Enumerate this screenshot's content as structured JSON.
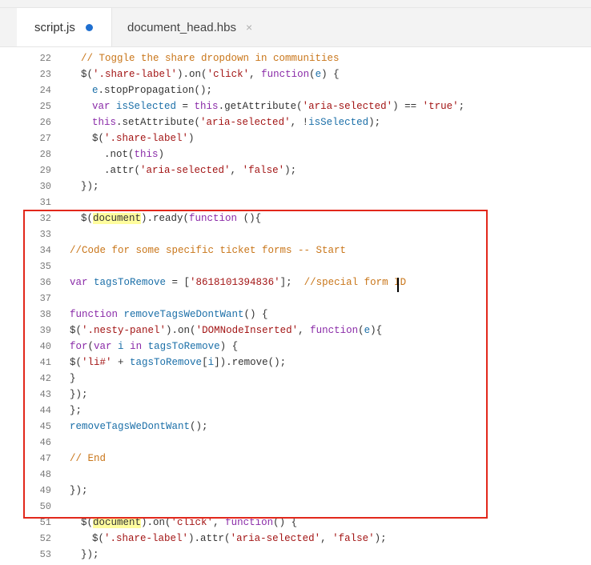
{
  "tabs": [
    {
      "label": "script.js",
      "active": true,
      "modified": true
    },
    {
      "label": "document_head.hbs",
      "active": false,
      "close": "×"
    }
  ],
  "lines": [
    {
      "n": "22",
      "segs": [
        {
          "t": "// Toggle the share dropdown in communities",
          "c": "c-com"
        }
      ]
    },
    {
      "n": "23",
      "segs": [
        {
          "t": "$(",
          "c": "c-fn"
        },
        {
          "t": "'.share-label'",
          "c": "c-str"
        },
        {
          "t": ").on(",
          "c": "c-fn"
        },
        {
          "t": "'click'",
          "c": "c-str"
        },
        {
          "t": ", ",
          "c": "c-fn"
        },
        {
          "t": "function",
          "c": "c-kw"
        },
        {
          "t": "(",
          "c": "c-fn"
        },
        {
          "t": "e",
          "c": "c-id"
        },
        {
          "t": ") {",
          "c": "c-fn"
        }
      ]
    },
    {
      "n": "24",
      "segs": [
        {
          "t": "e",
          "c": "c-id"
        },
        {
          "t": ".stopPropagation();",
          "c": "c-fn"
        }
      ]
    },
    {
      "n": "25",
      "segs": [
        {
          "t": "var ",
          "c": "c-kw"
        },
        {
          "t": "isSelected",
          "c": "c-id"
        },
        {
          "t": " = ",
          "c": "c-fn"
        },
        {
          "t": "this",
          "c": "c-kw"
        },
        {
          "t": ".getAttribute(",
          "c": "c-fn"
        },
        {
          "t": "'aria-selected'",
          "c": "c-str"
        },
        {
          "t": ") == ",
          "c": "c-fn"
        },
        {
          "t": "'true'",
          "c": "c-str"
        },
        {
          "t": ";",
          "c": "c-fn"
        }
      ]
    },
    {
      "n": "26",
      "segs": [
        {
          "t": "this",
          "c": "c-kw"
        },
        {
          "t": ".setAttribute(",
          "c": "c-fn"
        },
        {
          "t": "'aria-selected'",
          "c": "c-str"
        },
        {
          "t": ", !",
          "c": "c-fn"
        },
        {
          "t": "isSelected",
          "c": "c-id"
        },
        {
          "t": ");",
          "c": "c-fn"
        }
      ]
    },
    {
      "n": "27",
      "segs": [
        {
          "t": "$(",
          "c": "c-fn"
        },
        {
          "t": "'.share-label'",
          "c": "c-str"
        },
        {
          "t": ")",
          "c": "c-fn"
        }
      ]
    },
    {
      "n": "28",
      "segs": [
        {
          "t": ".not(",
          "c": "c-fn"
        },
        {
          "t": "this",
          "c": "c-kw"
        },
        {
          "t": ")",
          "c": "c-fn"
        }
      ]
    },
    {
      "n": "29",
      "segs": [
        {
          "t": ".attr(",
          "c": "c-fn"
        },
        {
          "t": "'aria-selected'",
          "c": "c-str"
        },
        {
          "t": ", ",
          "c": "c-fn"
        },
        {
          "t": "'false'",
          "c": "c-str"
        },
        {
          "t": ");",
          "c": "c-fn"
        }
      ]
    },
    {
      "n": "30",
      "segs": [
        {
          "t": "});",
          "c": "c-fn"
        }
      ]
    },
    {
      "n": "31",
      "segs": []
    },
    {
      "n": "32",
      "segs": [
        {
          "t": "$(",
          "c": "c-fn"
        },
        {
          "t": "document",
          "c": "hl"
        },
        {
          "t": ").ready(",
          "c": "c-fn"
        },
        {
          "t": "function",
          "c": "c-kw"
        },
        {
          "t": " (){",
          "c": "c-fn"
        }
      ]
    },
    {
      "n": "33",
      "segs": []
    },
    {
      "n": "34",
      "segs": [
        {
          "t": "//Code for some specific ticket forms -- Start",
          "c": "c-com"
        }
      ]
    },
    {
      "n": "35",
      "segs": []
    },
    {
      "n": "36",
      "segs": [
        {
          "t": "var ",
          "c": "c-kw"
        },
        {
          "t": "tagsToRemove",
          "c": "c-id"
        },
        {
          "t": " = [",
          "c": "c-fn"
        },
        {
          "t": "'8618101394836'",
          "c": "c-str"
        },
        {
          "t": "];  ",
          "c": "c-fn"
        },
        {
          "t": "//special form ID ",
          "c": "c-com"
        }
      ]
    },
    {
      "n": "37",
      "segs": []
    },
    {
      "n": "38",
      "segs": [
        {
          "t": "function ",
          "c": "c-kw"
        },
        {
          "t": "removeTagsWeDontWant",
          "c": "c-id"
        },
        {
          "t": "() {",
          "c": "c-fn"
        }
      ]
    },
    {
      "n": "39",
      "segs": [
        {
          "t": "$(",
          "c": "c-fn"
        },
        {
          "t": "'.nesty-panel'",
          "c": "c-str"
        },
        {
          "t": ").on(",
          "c": "c-fn"
        },
        {
          "t": "'DOMNodeInserted'",
          "c": "c-str"
        },
        {
          "t": ", ",
          "c": "c-fn"
        },
        {
          "t": "function",
          "c": "c-kw"
        },
        {
          "t": "(",
          "c": "c-fn"
        },
        {
          "t": "e",
          "c": "c-id"
        },
        {
          "t": "){",
          "c": "c-fn"
        }
      ]
    },
    {
      "n": "40",
      "segs": [
        {
          "t": "for",
          "c": "c-kw"
        },
        {
          "t": "(",
          "c": "c-fn"
        },
        {
          "t": "var ",
          "c": "c-kw"
        },
        {
          "t": "i",
          "c": "c-id"
        },
        {
          "t": " ",
          "c": "c-fn"
        },
        {
          "t": "in",
          "c": "c-kw"
        },
        {
          "t": " ",
          "c": "c-fn"
        },
        {
          "t": "tagsToRemove",
          "c": "c-id"
        },
        {
          "t": ") {",
          "c": "c-fn"
        }
      ]
    },
    {
      "n": "41",
      "segs": [
        {
          "t": "$(",
          "c": "c-fn"
        },
        {
          "t": "'li#'",
          "c": "c-str"
        },
        {
          "t": " + ",
          "c": "c-fn"
        },
        {
          "t": "tagsToRemove",
          "c": "c-id"
        },
        {
          "t": "[",
          "c": "c-fn"
        },
        {
          "t": "i",
          "c": "c-id"
        },
        {
          "t": "]).remove();",
          "c": "c-fn"
        }
      ]
    },
    {
      "n": "42",
      "segs": [
        {
          "t": "}",
          "c": "c-fn"
        }
      ]
    },
    {
      "n": "43",
      "segs": [
        {
          "t": "});",
          "c": "c-fn"
        }
      ]
    },
    {
      "n": "44",
      "segs": [
        {
          "t": "};",
          "c": "c-fn"
        }
      ]
    },
    {
      "n": "45",
      "segs": [
        {
          "t": "removeTagsWeDontWant",
          "c": "c-id"
        },
        {
          "t": "();",
          "c": "c-fn"
        }
      ]
    },
    {
      "n": "46",
      "segs": []
    },
    {
      "n": "47",
      "segs": [
        {
          "t": "// End",
          "c": "c-com"
        }
      ]
    },
    {
      "n": "48",
      "segs": []
    },
    {
      "n": "49",
      "segs": [
        {
          "t": "});",
          "c": "c-fn"
        }
      ]
    },
    {
      "n": "50",
      "segs": []
    },
    {
      "n": "51",
      "segs": [
        {
          "t": "$(",
          "c": "c-fn"
        },
        {
          "t": "document",
          "c": "hl"
        },
        {
          "t": ").on(",
          "c": "c-fn"
        },
        {
          "t": "'click'",
          "c": "c-str"
        },
        {
          "t": ", ",
          "c": "c-fn"
        },
        {
          "t": "function",
          "c": "c-kw"
        },
        {
          "t": "() {",
          "c": "c-fn"
        }
      ]
    },
    {
      "n": "52",
      "segs": [
        {
          "t": "$(",
          "c": "c-fn"
        },
        {
          "t": "'.share-label'",
          "c": "c-str"
        },
        {
          "t": ").attr(",
          "c": "c-fn"
        },
        {
          "t": "'aria-selected'",
          "c": "c-str"
        },
        {
          "t": ", ",
          "c": "c-fn"
        },
        {
          "t": "'false'",
          "c": "c-str"
        },
        {
          "t": ");",
          "c": "c-fn"
        }
      ]
    },
    {
      "n": "53",
      "segs": [
        {
          "t": "});",
          "c": "c-fn"
        }
      ]
    }
  ],
  "colors": {
    "highlight_box": "#e2281b",
    "modified_dot": "#1f6fd0",
    "word_highlight": "#fffd9e"
  }
}
